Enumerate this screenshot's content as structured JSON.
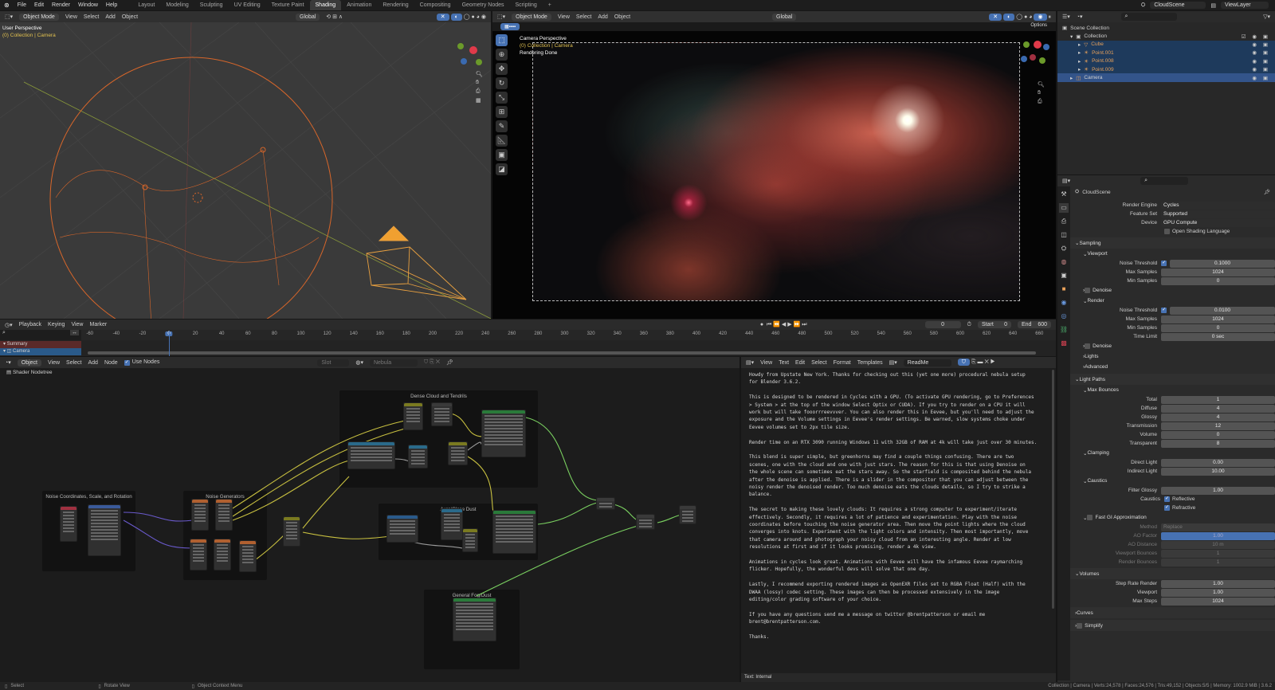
{
  "topbar": {
    "menus": [
      "File",
      "Edit",
      "Render",
      "Window",
      "Help"
    ],
    "workspaces": [
      "Layout",
      "Modeling",
      "Sculpting",
      "UV Editing",
      "Texture Paint",
      "Shading",
      "Animation",
      "Rendering",
      "Compositing",
      "Geometry Nodes",
      "Scripting",
      "+"
    ],
    "active_workspace": "Shading",
    "scene": "CloudScene",
    "view_layer": "ViewLayer"
  },
  "viewport3d": {
    "mode": "Object Mode",
    "menus": [
      "View",
      "Select",
      "Add",
      "Object"
    ],
    "transform": "Global",
    "title": "User Perspective",
    "collection": "(0) Collection | Camera"
  },
  "camera_view": {
    "mode": "Object Mode",
    "menus": [
      "View",
      "Select",
      "Add",
      "Object"
    ],
    "transform": "Global",
    "options": "Options",
    "title": "Camera Perspective",
    "collection": "(0) Collection | Camera",
    "status": "Rendering Done"
  },
  "outliner": {
    "items": [
      {
        "name": "Scene Collection",
        "level": 0
      },
      {
        "name": "Collection",
        "level": 1
      },
      {
        "name": "Cube",
        "level": 2,
        "icon": "mesh"
      },
      {
        "name": "Point.001",
        "level": 2,
        "icon": "light"
      },
      {
        "name": "Point.008",
        "level": 2,
        "icon": "light"
      },
      {
        "name": "Point.009",
        "level": 2,
        "icon": "light"
      },
      {
        "name": "Camera",
        "level": 1,
        "icon": "camera"
      }
    ]
  },
  "properties": {
    "scene": "CloudScene",
    "rows": [
      {
        "t": "field",
        "label": "Render Engine",
        "value": "Cycles",
        "dd": true
      },
      {
        "t": "field",
        "label": "Feature Set",
        "value": "Supported",
        "dd": true
      },
      {
        "t": "field",
        "label": "Device",
        "value": "GPU Compute",
        "dd": true
      },
      {
        "t": "check",
        "label": "Open Shading Language",
        "on": false
      },
      {
        "t": "sec",
        "label": "Sampling"
      },
      {
        "t": "sub",
        "label": "Viewport"
      },
      {
        "t": "field",
        "label": "Noise Threshold",
        "value": "0.1000",
        "check": true
      },
      {
        "t": "field",
        "label": "Max Samples",
        "value": "1024"
      },
      {
        "t": "field",
        "label": "Min Samples",
        "value": "0"
      },
      {
        "t": "subc",
        "label": "Denoise",
        "open": false
      },
      {
        "t": "sub",
        "label": "Render"
      },
      {
        "t": "field",
        "label": "Noise Threshold",
        "value": "0.0100",
        "check": true
      },
      {
        "t": "field",
        "label": "Max Samples",
        "value": "1024"
      },
      {
        "t": "field",
        "label": "Min Samples",
        "value": "0"
      },
      {
        "t": "field",
        "label": "Time Limit",
        "value": "0 sec"
      },
      {
        "t": "subc",
        "label": "Denoise",
        "open": false
      },
      {
        "t": "subx",
        "label": "Lights"
      },
      {
        "t": "subx",
        "label": "Advanced"
      },
      {
        "t": "sec",
        "label": "Light Paths"
      },
      {
        "t": "sub",
        "label": "Max Bounces"
      },
      {
        "t": "field",
        "label": "Total",
        "value": "1"
      },
      {
        "t": "field",
        "label": "Diffuse",
        "value": "4"
      },
      {
        "t": "field",
        "label": "Glossy",
        "value": "4"
      },
      {
        "t": "field",
        "label": "Transmission",
        "value": "12"
      },
      {
        "t": "field",
        "label": "Volume",
        "value": "0"
      },
      {
        "t": "field",
        "label": "Transparent",
        "value": "8"
      },
      {
        "t": "sub",
        "label": "Clamping"
      },
      {
        "t": "field",
        "label": "Direct Light",
        "value": "0.00"
      },
      {
        "t": "field",
        "label": "Indirect Light",
        "value": "10.00"
      },
      {
        "t": "sub",
        "label": "Caustics"
      },
      {
        "t": "field",
        "label": "Filter Glossy",
        "value": "1.00"
      },
      {
        "t": "check",
        "label": "Reflective",
        "on": true,
        "side": "Caustics"
      },
      {
        "t": "check",
        "label": "Refractive",
        "on": true
      },
      {
        "t": "subc",
        "label": "Fast GI Approximation",
        "open": true
      },
      {
        "t": "field",
        "label": "Method",
        "value": "Replace",
        "dim": true,
        "dd": true
      },
      {
        "t": "field",
        "label": "AO Factor",
        "value": "1.00",
        "dim": true,
        "hl": true
      },
      {
        "t": "field",
        "label": "AO Distance",
        "value": "10 m",
        "dim": true
      },
      {
        "t": "field",
        "label": "Viewport Bounces",
        "value": "1",
        "dim": true
      },
      {
        "t": "field",
        "label": "Render Bounces",
        "value": "1",
        "dim": true
      },
      {
        "t": "sec",
        "label": "Volumes"
      },
      {
        "t": "field",
        "label": "Step Rate Render",
        "value": "1.00"
      },
      {
        "t": "field",
        "label": "Viewport",
        "value": "1.00"
      },
      {
        "t": "field",
        "label": "Max Steps",
        "value": "1024"
      },
      {
        "t": "secx",
        "label": "Curves"
      },
      {
        "t": "secc",
        "label": "Simplify"
      }
    ]
  },
  "timeline": {
    "menus": [
      "Playback",
      "Keying",
      "View",
      "Marker"
    ],
    "ticks": [
      "-60",
      "-40",
      "-20",
      "0",
      "20",
      "40",
      "60",
      "80",
      "100",
      "120",
      "140",
      "160",
      "180",
      "200",
      "220",
      "240",
      "260",
      "280",
      "300",
      "320",
      "340",
      "360",
      "380",
      "400",
      "420",
      "440",
      "460",
      "480",
      "500",
      "520",
      "540",
      "560",
      "580",
      "600",
      "620",
      "640",
      "660"
    ],
    "current_frame": "0",
    "start_label": "Start",
    "start": "0",
    "end_label": "End",
    "end": "600",
    "channels": [
      "Summary",
      "Camera"
    ]
  },
  "node_editor": {
    "type": "Object",
    "menus": [
      "View",
      "Select",
      "Add",
      "Node"
    ],
    "use_nodes": "Use Nodes",
    "slot": "Slot",
    "material": "Nebula",
    "breadcrumb": "Shader Nodetree",
    "frames": [
      "Noise Coordinates, Scale, and Rotation",
      "Noise Generators",
      "Dense Cloud and Tendrils",
      "Aura/Close Dust",
      "General Fog/Dust"
    ]
  },
  "text_editor": {
    "menus": [
      "View",
      "Text",
      "Edit",
      "Select",
      "Format",
      "Templates"
    ],
    "file": "ReadMe",
    "footer": "Text: Internal",
    "lines": [
      "Howdy from Upstate New York. Thanks for checking out this (yet one more) procedural nebula setup",
      "for Blender 3.6.2.",
      "",
      "This is designed to be rendered in Cycles with a GPU. (To activate GPU rendering, go to Preferences",
      "> System > at the top of the window Select Optix or CUDA). If you try to render on a CPU it will",
      "work but will take fooorrreevvver. You can also render this in Eevee, but you'll need to adjust the",
      "exposure and the Volume settings in Eevee's render settings. Be warned, slow systems choke under",
      "Eevee volumes set to 2px tile size.",
      "",
      "Render time on an RTX 3090 running Windows 11 with 32GB of RAM at 4k will take just over 30 minutes.",
      "",
      "This blend is super simple, but greenhorns may find a couple things confusing. There are two",
      "scenes, one with the cloud and one with just stars. The reason for this is that using Denoise on",
      "the whole scene can sometimes eat the stars away. So the starfield is composited behind the nebula",
      "after the denoise is applied. There is a slider in the compositor that you can adjust between the",
      "noisy render the denoised render. Too much denoise eats the clouds details, so I try to strike a",
      "balance.",
      "",
      "The secret to making these lovely clouds: It requires a strong computer to experiment/iterate",
      "effectively. Secondly, it requires a lot of patience and experimentation. Play with the noise",
      "coordinates before touching the noise generator area. Then move the point lights where the cloud",
      "converges into knots. Experiment with the light colors and intensity. Then most importantly, move",
      "that camera around and photograph your noisy cloud from an interesting angle. Render at low",
      "resolutions at first and if it looks promising, render a 4k view.",
      "",
      "Animations in cycles look great. Animations with Eevee will have the infamous Eevee raymarching",
      "flicker. Hopefully, the wonderful devs will solve that one day.",
      "",
      "Lastly, I recommend exporting rendered images as OpenEXR files set to RGBA Float (Half) with the",
      "DWAA (lossy) codec setting. These images can then be processed extensively in the image",
      "editing/color grading software of your choice.",
      "",
      "If you have any questions send me a message on twitter @brentpatterson or email me",
      "brent@brentpatterson.com.",
      "",
      "Thanks."
    ]
  },
  "statusbar": {
    "hints": [
      "Select",
      "Rotate View",
      "Object Context Menu"
    ],
    "stats": "Collection | Camera | Verts:24,578 | Faces:24,576 | Tris:49,152 | Objects:5/5 | Memory: 1002.9 MiB | 3.6.2"
  },
  "colors": {
    "accent": "#4772b3",
    "object_orange": "#e8a15a",
    "active_overlay": "#e0c050"
  }
}
